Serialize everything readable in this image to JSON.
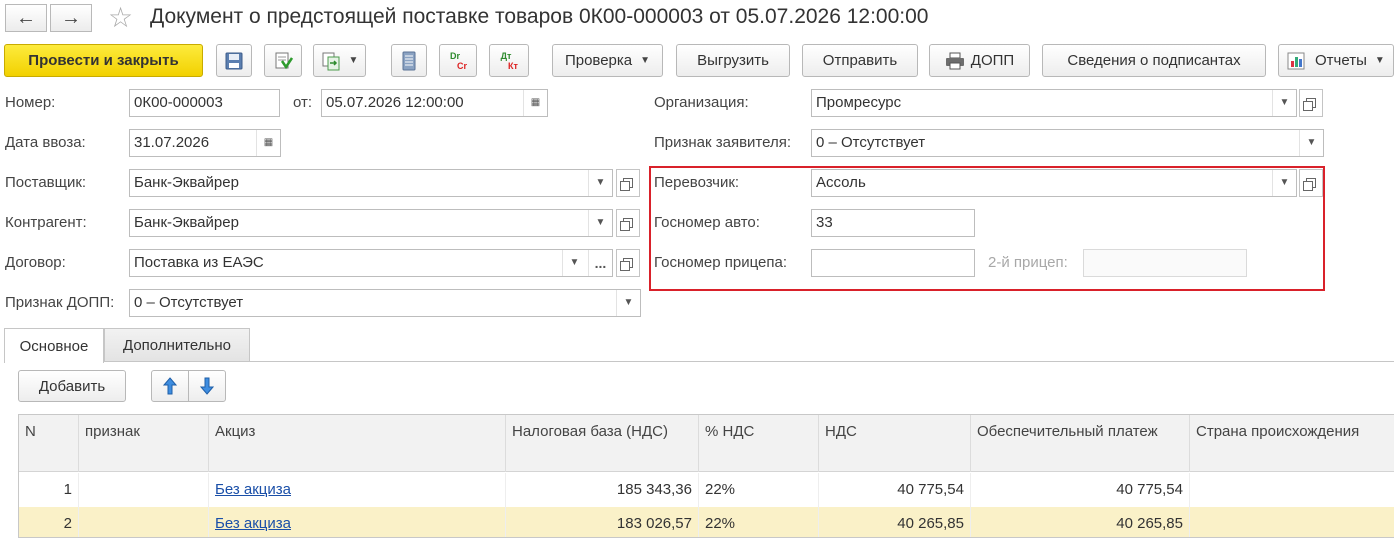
{
  "window": {
    "title": "Документ о предстоящей поставке товаров 0К00-000003 от 05.07.2026 12:00:00"
  },
  "toolbar": {
    "post_close": "Провести и закрыть",
    "check": "Проверка",
    "export": "Выгрузить",
    "send": "Отправить",
    "dopp": "ДОПП",
    "signers": "Сведения о подписантах",
    "reports": "Отчеты",
    "dt_kt_top": "Dr",
    "dt_kt_bottom": "Cr",
    "dtkt2_top": "Дт",
    "dtkt2_bottom": "Кт"
  },
  "form": {
    "number_label": "Номер:",
    "number_value": "0К00-000003",
    "from_label": "от:",
    "from_value": "05.07.2026 12:00:00",
    "import_date_label": "Дата ввоза:",
    "import_date_value": "31.07.2026",
    "supplier_label": "Поставщик:",
    "supplier_value": "Банк-Эквайрер",
    "counterparty_label": "Контрагент:",
    "counterparty_value": "Банк-Эквайрер",
    "contract_label": "Договор:",
    "contract_value": "Поставка из ЕАЭС",
    "contract_dots": "...",
    "dopp_sign_label": "Признак ДОПП:",
    "dopp_sign_value": "0 – Отсутствует",
    "org_label": "Организация:",
    "org_value": "Промресурс",
    "applicant_label": "Признак заявителя:",
    "applicant_value": "0 – Отсутствует",
    "carrier_label": "Перевозчик:",
    "carrier_value": "Ассоль",
    "car_plate_label": "Госномер авто:",
    "car_plate_value": "33",
    "trailer_plate_label": "Госномер прицепа:",
    "trailer_plate_value": "",
    "trailer2_label": "2-й прицеп:",
    "trailer2_value": ""
  },
  "tabs": [
    {
      "label": "Основное"
    },
    {
      "label": "Дополнительно"
    }
  ],
  "table_toolbar": {
    "add": "Добавить"
  },
  "table": {
    "columns": [
      "N",
      "признак",
      "Акциз",
      "Налоговая база (НДС)",
      "% НДС",
      "НДС",
      "Обеспечительный платеж",
      "Страна происхождения"
    ],
    "rows": [
      {
        "n": "1",
        "sign": "",
        "excise": "Без акциза",
        "tax_base": "185 343,36",
        "vat_pct": "22%",
        "vat": "40 775,54",
        "payment": "40 775,54",
        "country": ""
      },
      {
        "n": "2",
        "sign": "",
        "excise": "Без акциза",
        "tax_base": "183 026,57",
        "vat_pct": "22%",
        "vat": "40 265,85",
        "payment": "40 265,85",
        "country": ""
      }
    ]
  },
  "colors": {
    "primary_button": "#f2d100",
    "highlight_border": "#d9212a",
    "selected_row": "#faf1c8",
    "link": "#1a4fa8"
  }
}
